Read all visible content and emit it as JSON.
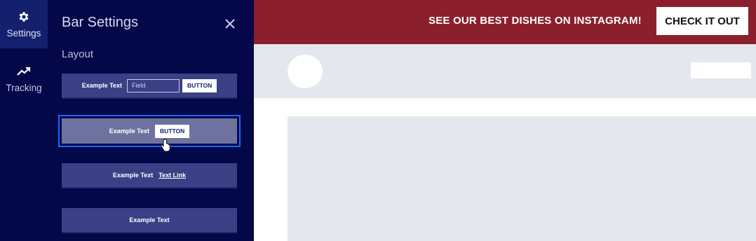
{
  "rail": {
    "items": [
      {
        "label": "Settings",
        "icon": "gear-icon",
        "active": true
      },
      {
        "label": "Tracking",
        "icon": "trending-up-icon",
        "active": false
      }
    ]
  },
  "panel": {
    "title": "Bar Settings",
    "close_icon": "close-icon",
    "section_label": "Layout",
    "options": [
      {
        "text": "Example Text",
        "field_placeholder": "Field",
        "button": "BUTTON"
      },
      {
        "text": "Example Text",
        "button": "BUTTON",
        "selected": true
      },
      {
        "text": "Example Text",
        "link": "Text Link"
      },
      {
        "text": "Example Text"
      }
    ]
  },
  "preview": {
    "banner_text": "SEE OUR BEST DISHES ON INSTAGRAM!",
    "banner_button": "CHECK IT OUT"
  },
  "colors": {
    "navy": "#040849",
    "rail_active": "#14206e",
    "option_bg": "#3a3f86",
    "selected_bg": "#6e729e",
    "focus_blue": "#146bff",
    "banner_red": "#8b1f2c",
    "placeholder_gray": "#e5e7ef"
  }
}
